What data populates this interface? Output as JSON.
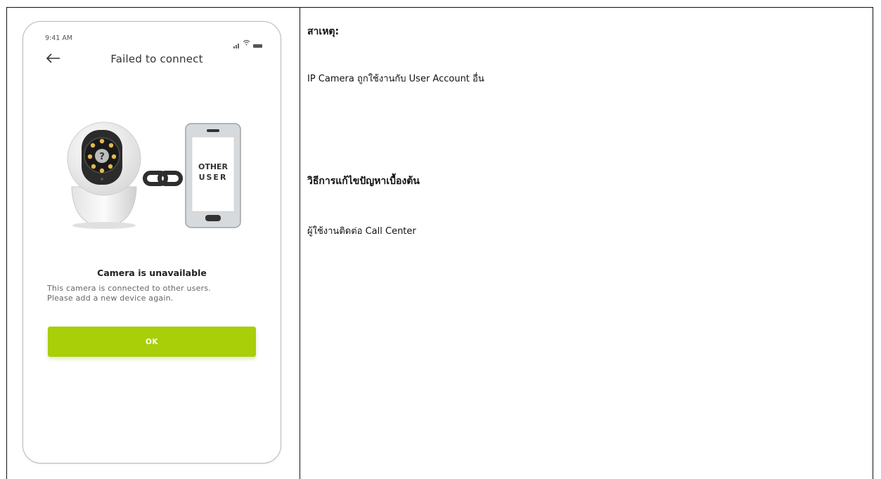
{
  "phone": {
    "status_time": "9:41 AM",
    "status_icons": [
      "signal-icon",
      "wifi-icon",
      "battery-icon"
    ],
    "screen_title": "Failed to connect",
    "illustration": {
      "phone_label_line1": "OTHER",
      "phone_label_line2": "USER",
      "camera_badge": "?"
    },
    "message_title": "Camera is unavailable",
    "message_line1": "This camera is connected to other users.",
    "message_line2": "Please add a new device again.",
    "ok_label": "OK"
  },
  "notes": {
    "cause_heading": "สาเหตุ:",
    "cause_text": "IP Camera ถูกใช้งานกับ User Account อื่น",
    "fix_heading": "วิธีการแก้ไขปัญหาเบื้องต้น",
    "fix_text": "ผู้ใช้งานติดต่อ Call Center"
  },
  "colors": {
    "accent": "#a8cf08",
    "border": "#111111"
  }
}
